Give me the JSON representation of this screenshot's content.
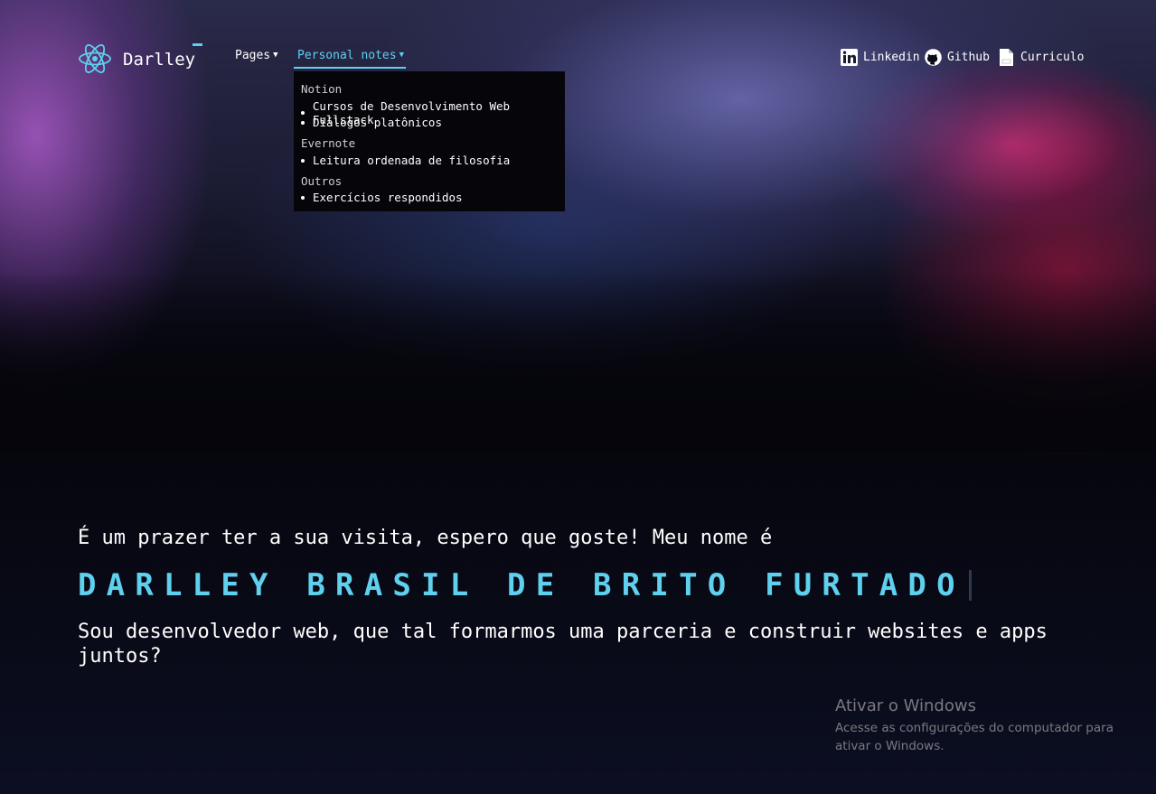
{
  "navbar": {
    "brand": "Darlley",
    "pages_label": "Pages",
    "notes_label": "Personal notes",
    "active_color": "#5fd0ee"
  },
  "dropdown": {
    "groups": [
      {
        "title": "Notion",
        "items": [
          "Cursos de Desenvolvimento Web Fullstack",
          "Diálogos platônicos"
        ]
      },
      {
        "title": "Evernote",
        "items": [
          "Leitura ordenada de filosofia"
        ]
      },
      {
        "title": "Outros",
        "items": [
          "Exercícios respondidos"
        ]
      }
    ]
  },
  "social": {
    "linkedin": "Linkedin",
    "github": "Github",
    "cv": "Curriculo"
  },
  "hero": {
    "greeting": "É um prazer ter a sua visita, espero que goste! Meu nome é",
    "name": "DARLLEY BRASIL DE BRITO FURTADO",
    "tagline": "Sou desenvolvedor web, que tal formarmos uma parceria e construir websites e apps juntos?"
  },
  "windows_watermark": {
    "title": "Ativar o Windows",
    "subtitle": "Acesse as configurações do computador para ativar o Windows."
  },
  "icons": [
    "react-atom-icon",
    "chevron-down-icon",
    "linkedin-icon",
    "github-icon",
    "pdf-icon"
  ]
}
